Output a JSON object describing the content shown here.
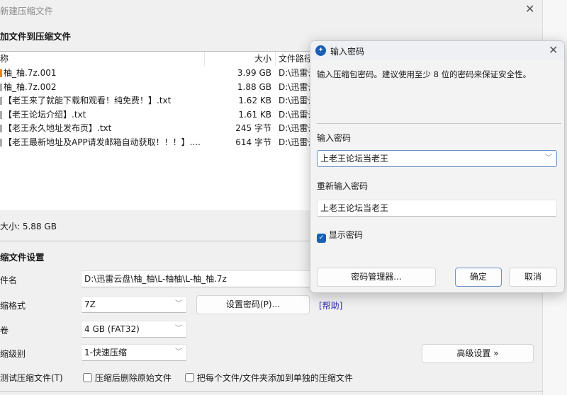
{
  "main": {
    "title": "新建压缩文件",
    "heading": "加文件到压缩文件",
    "columns": {
      "name": "称",
      "size": "大小",
      "path": "文件路径"
    },
    "files": [
      {
        "name": "柚_柚.7z.001",
        "size": "3.99 GB",
        "path": "D:\\迅雷云"
      },
      {
        "name": "柚_柚.7z.002",
        "size": "1.88 GB",
        "path": "D:\\迅雷云"
      },
      {
        "name": "【老王来了就能下载和观看！纯免费！】.txt",
        "size": "1.62 KB",
        "path": "D:\\迅雷云"
      },
      {
        "name": "【老王论坛介绍】.txt",
        "size": "1.61 KB",
        "path": "D:\\迅雷云"
      },
      {
        "name": "【老王永久地址发布页】.txt",
        "size": "245 字节",
        "path": "D:\\迅雷云"
      },
      {
        "name": "【老王最新地址及APP请发邮箱自动获取！！！】....",
        "size": "614 字节",
        "path": "D:\\迅雷云"
      }
    ],
    "total": "大小: 5.88 GB",
    "settings_heading": "缩文件设置",
    "filename_label": "件名",
    "filename_value": "D:\\迅雷云盘\\柚_柚\\L-柚柚\\L-柚_柚.7z",
    "format_label": "缩格式",
    "format_value": "7Z",
    "set_password": "设置密码(P)...",
    "help": "[帮助]",
    "volume_label": "卷",
    "volume_value": "4 GB (FAT32)",
    "level_label": "缩级别",
    "level_value": "1-快速压缩",
    "advanced": "高级设置 »",
    "test_label": "测试压缩文件(T)",
    "delete_after": "压缩后删除原始文件",
    "each_separate": "把每个文件/文件夹添加到单独的压缩文件"
  },
  "dialog": {
    "title": "输入密码",
    "description": "输入压缩包密码。建议使用至少 8 位的密码来保证安全性。",
    "password_label": "输入密码",
    "password_value": "上老王论坛当老王",
    "confirm_label": "重新输入密码",
    "confirm_value": "上老王论坛当老王",
    "show_password": "显示密码",
    "show_password_checked": true,
    "manager": "密码管理器...",
    "ok": "确定",
    "cancel": "取消",
    "accent": "#1a5fb4"
  }
}
